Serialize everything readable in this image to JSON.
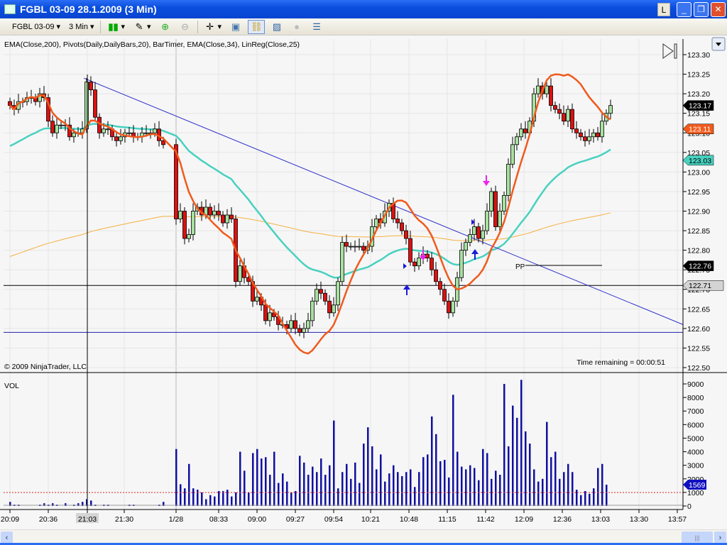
{
  "window": {
    "title": "FGBL 03-09  28.1.2009 (3 Min)",
    "l_button": "L",
    "minimize": "_",
    "restore": "❐",
    "close": "✕"
  },
  "toolbar": {
    "instrument": "FGBL 03-09",
    "interval": "3 Min",
    "icons": [
      "candlestick-icon",
      "pencil-icon",
      "zoom-in-icon",
      "zoom-out-icon",
      "crosshair-icon",
      "properties-icon",
      "link-icon",
      "indicator-icon",
      "strategy-icon",
      "data-box-icon"
    ]
  },
  "chart_data": {
    "type": "candlestick",
    "indicators_label": "EMA(Close,200), Pivots(Daily,DailyBars,20), BarTimer, EMA(Close,34), LinReg(Close,25)",
    "copyright": "© 2009 NinjaTrader, LLC",
    "bar_timer": "Time remaining = 00:00:51",
    "volume_label": "VOL",
    "price_axis": {
      "min": 122.5,
      "max": 123.3,
      "ticks": [
        "123.30",
        "123.25",
        "123.20",
        "123.15",
        "123.10",
        "123.05",
        "123.00",
        "122.95",
        "122.90",
        "122.85",
        "122.80",
        "122.75",
        "122.70",
        "122.65",
        "122.60",
        "122.55",
        "122.50"
      ]
    },
    "volume_axis": {
      "min": 0,
      "max": 9000,
      "ticks": [
        "9000",
        "8000",
        "7000",
        "6000",
        "5000",
        "4000",
        "3000",
        "2000",
        "1000",
        "0"
      ]
    },
    "x_ticks": [
      "20:09",
      "20:36",
      "21:03",
      "21:30",
      "1/28",
      "08:33",
      "09:00",
      "09:27",
      "09:54",
      "10:21",
      "10:48",
      "11:15",
      "11:42",
      "12:09",
      "12:36",
      "13:03",
      "13:30",
      "13:57"
    ],
    "crosshair_time": "21:03",
    "markers": {
      "last_price": "123.17",
      "linreg": "123.11",
      "ema34": "123.03",
      "pivot_pp": "122.76",
      "horizontal_line": "122.71",
      "volume_last": "1569"
    },
    "pivot_label": "PP",
    "pivot_pp": 122.76,
    "horizontal_lines": [
      122.71,
      122.59
    ],
    "trendline": {
      "start_price": 123.24,
      "end_price": 122.61
    },
    "ema200_seed": 122.78,
    "ema34_seed": 123.06,
    "colors": {
      "up": "#a8e0a0",
      "down": "#dd1111",
      "ema200": "#f5b041",
      "ema34": "#48d1c0",
      "linreg": "#f05a1c",
      "volume": "#1010a0",
      "trend": "#3333cc"
    },
    "evening_close": [
      123.17,
      123.16,
      123.18,
      123.18,
      123.19,
      123.19,
      123.18,
      123.2,
      123.19,
      123.13,
      123.1,
      123.12,
      123.12,
      123.12,
      123.09,
      123.1,
      123.1,
      123.11,
      123.23,
      123.21,
      123.14,
      123.1,
      123.11,
      123.11,
      123.09,
      123.08,
      123.09,
      123.1,
      123.1,
      123.09,
      123.09,
      123.1,
      123.1,
      123.1,
      123.11,
      123.08,
      123.07
    ],
    "morning_close": [
      122.88,
      122.9,
      122.83,
      122.84,
      122.9,
      122.91,
      122.89,
      122.91,
      122.89,
      122.9,
      122.89,
      122.87,
      122.89,
      122.88,
      122.72,
      122.76,
      122.73,
      122.72,
      122.67,
      122.68,
      122.66,
      122.62,
      122.64,
      122.63,
      122.61,
      122.61,
      122.6,
      122.62,
      122.6,
      122.59,
      122.6,
      122.62,
      122.67,
      122.7,
      122.69,
      122.67,
      122.64,
      122.66,
      122.72,
      122.82,
      122.81,
      122.81,
      122.81,
      122.81,
      122.8,
      122.81,
      122.86,
      122.88,
      122.87,
      122.9,
      122.92,
      122.88,
      122.87,
      122.85,
      122.83,
      122.77,
      122.76,
      122.78,
      122.79,
      122.78,
      122.75,
      122.72,
      122.7,
      122.67,
      122.64,
      122.67,
      122.73,
      122.8,
      122.82,
      122.84,
      122.86,
      122.83,
      122.85,
      122.9,
      122.95,
      122.86,
      122.9,
      122.94,
      123.02,
      123.07,
      123.09,
      123.11,
      123.1,
      123.13,
      123.2,
      123.22,
      123.2,
      123.22,
      123.17,
      123.16,
      123.15,
      123.13,
      123.16,
      123.11,
      123.1,
      123.09,
      123.08,
      123.09,
      123.1,
      123.09,
      123.13,
      123.15,
      123.17
    ],
    "evening_volume": [
      300,
      100,
      100,
      0,
      0,
      0,
      0,
      100,
      200,
      100,
      200,
      100,
      0,
      200,
      0,
      100,
      200,
      300,
      500,
      400,
      100,
      0,
      100,
      100,
      0,
      0,
      0,
      0,
      100,
      100,
      0,
      0,
      0,
      0,
      0,
      100,
      300
    ],
    "morning_volume": [
      4200,
      1600,
      1300,
      3100,
      1300,
      1200,
      1000,
      500,
      800,
      700,
      1100,
      1100,
      1200,
      700,
      1000,
      4000,
      2600,
      1000,
      3900,
      4200,
      3500,
      3600,
      2300,
      4000,
      1700,
      2400,
      1800,
      1000,
      1100,
      3700,
      3200,
      2300,
      2900,
      2500,
      3500,
      2300,
      3000,
      6300,
      1300,
      2500,
      3100,
      2000,
      3200,
      1700,
      4600,
      5800,
      4400,
      2700,
      3800,
      1800,
      2400,
      3000,
      2500,
      2200,
      2500,
      2700,
      1400,
      2500,
      3600,
      3800,
      6600,
      5300,
      3300,
      3400,
      2100,
      8200,
      4000,
      2900,
      2700,
      3000,
      2800,
      1900,
      4200,
      3900,
      2000,
      2600,
      2300,
      9000,
      4400,
      7400,
      6500,
      9300,
      5500,
      4600,
      2700,
      1800,
      2000,
      6200,
      3600,
      4000,
      2000,
      2500,
      3100,
      2500,
      1200,
      800,
      1100,
      900,
      1300,
      2800,
      3100,
      1569
    ]
  },
  "scroll": {
    "left": "‹",
    "right": "›",
    "thumb": "|||"
  }
}
